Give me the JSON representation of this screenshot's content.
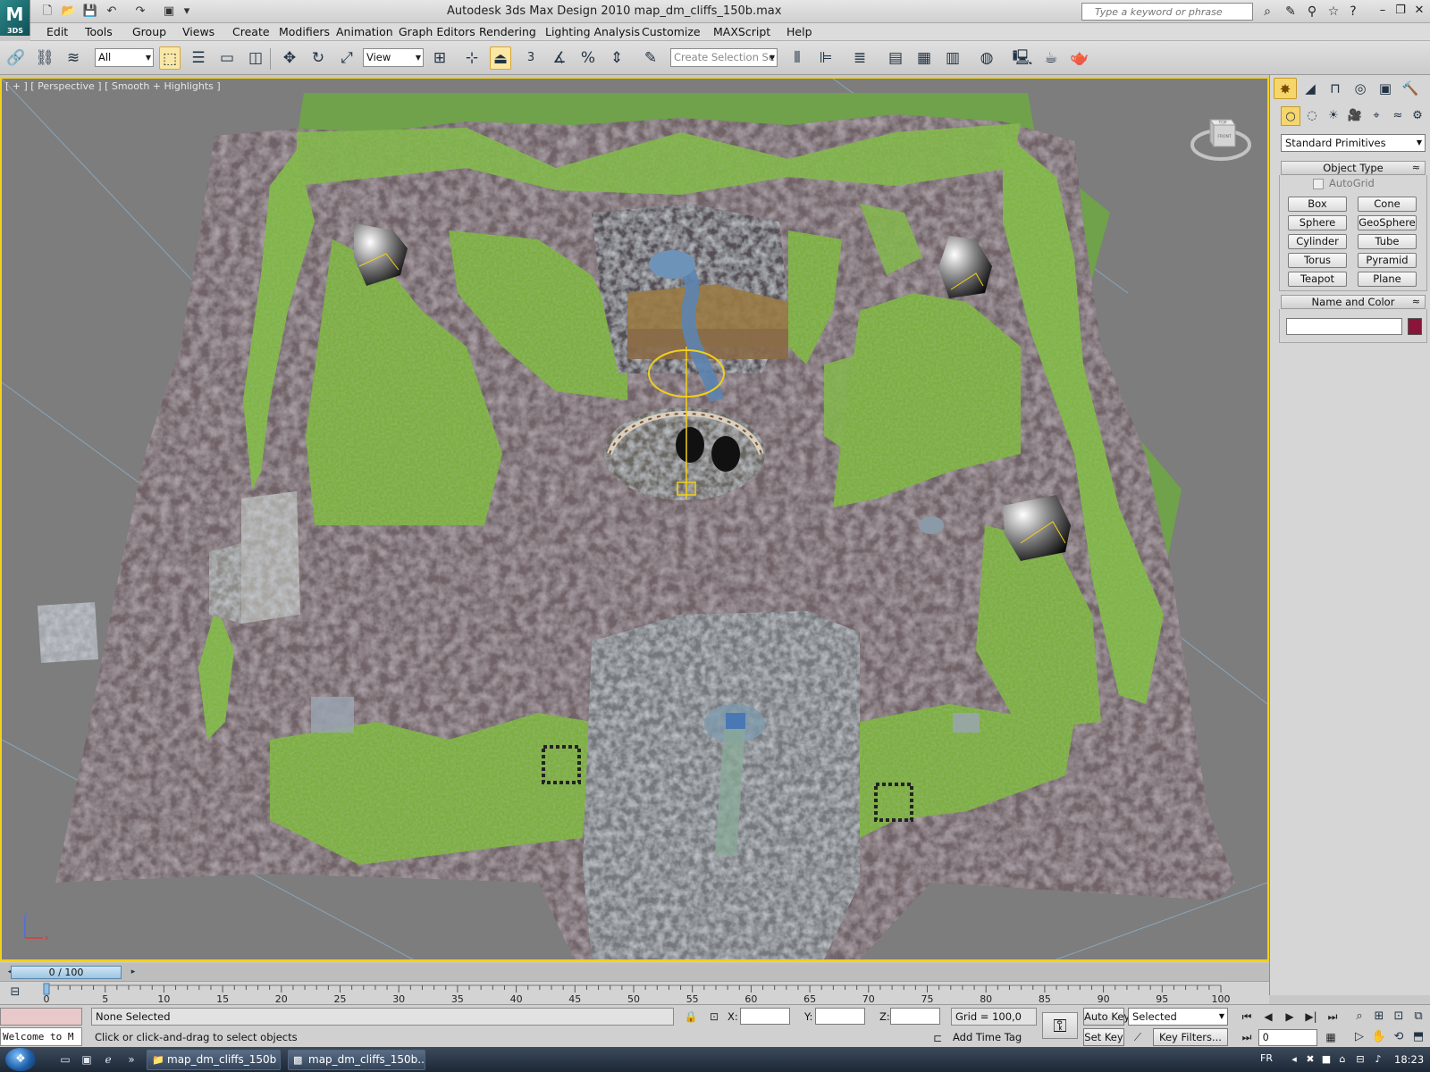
{
  "titlebar": {
    "app_logo": "3DS",
    "title": "Autodesk 3ds Max Design 2010      map_dm_cliffs_150b.max",
    "search_placeholder": "Type a keyword or phrase"
  },
  "menu": [
    "Edit",
    "Tools",
    "Group",
    "Views",
    "Create",
    "Modifiers",
    "Animation",
    "Graph Editors",
    "Rendering",
    "Lighting Analysis",
    "Customize",
    "MAXScript",
    "Help"
  ],
  "toolbar": {
    "selection_filter": "All",
    "reference_coord": "View",
    "snap_angle_label": "3",
    "named_selection_placeholder": "Create Selection Se"
  },
  "viewport": {
    "label": "[ + ] [ Perspective ] [ Smooth + Highlights ]",
    "viewcube_top": "TOP",
    "viewcube_front": "FRONT",
    "axis_z": "z",
    "axis_x": "x"
  },
  "command_panel": {
    "category_dropdown": "Standard Primitives",
    "object_type_title": "Object Type",
    "autogrid_label": "AutoGrid",
    "primitives": [
      "Box",
      "Cone",
      "Sphere",
      "GeoSphere",
      "Cylinder",
      "Tube",
      "Torus",
      "Pyramid",
      "Teapot",
      "Plane"
    ],
    "name_color_title": "Name and Color",
    "object_color": "#8b1538"
  },
  "timeline": {
    "slider_label": "0 / 100",
    "frame_current": 0,
    "frame_end": 100,
    "tick_labels": [
      "0",
      "5",
      "10",
      "15",
      "20",
      "25",
      "30",
      "35",
      "40",
      "45",
      "50",
      "55",
      "60",
      "65",
      "70",
      "75",
      "80",
      "85",
      "90",
      "95",
      "100"
    ]
  },
  "status": {
    "listener_text": "Welcome to M",
    "selection_status": "None Selected",
    "prompt": "Click or click-and-drag to select objects",
    "x_label": "X:",
    "y_label": "Y:",
    "z_label": "Z:",
    "grid": "Grid = 100,0",
    "add_time_tag": "Add Time Tag",
    "auto_key": "Auto Key",
    "set_key": "Set Key",
    "key_mode": "Selected",
    "key_filters": "Key Filters...",
    "current_frame": "0"
  },
  "taskbar": {
    "tasks": [
      "map_dm_cliffs_150b",
      "map_dm_cliffs_150b..."
    ],
    "language": "FR",
    "clock": "18:23"
  },
  "colors": {
    "viewport_border": "#f2d01a",
    "active_tool": "#fbe7a5",
    "grass": "#79ad3d",
    "rock": "#7a6c70"
  }
}
